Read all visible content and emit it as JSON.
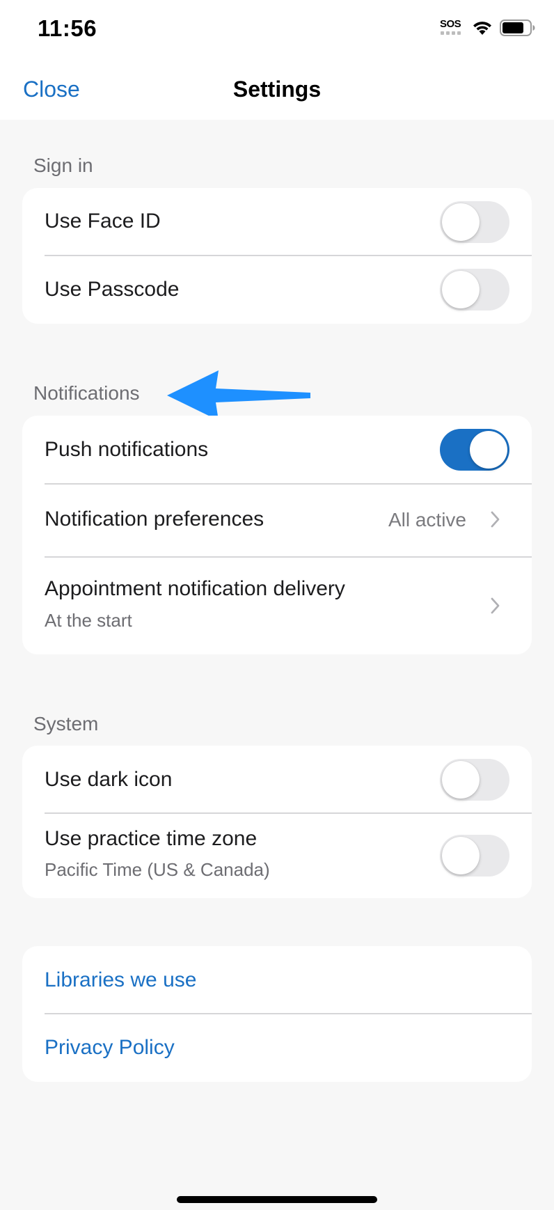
{
  "status_bar": {
    "time": "11:56",
    "sos": "SOS"
  },
  "nav": {
    "close_label": "Close",
    "title": "Settings"
  },
  "sections": {
    "sign_in": {
      "header": "Sign in",
      "rows": [
        {
          "label": "Use Face ID",
          "toggle_on": false
        },
        {
          "label": "Use Passcode",
          "toggle_on": false
        }
      ]
    },
    "notifications": {
      "header": "Notifications",
      "rows": [
        {
          "label": "Push notifications",
          "toggle_on": true
        },
        {
          "label": "Notification preferences",
          "value": "All active"
        },
        {
          "label": "Appointment notification delivery",
          "subtitle": "At the start"
        }
      ]
    },
    "system": {
      "header": "System",
      "rows": [
        {
          "label": "Use dark icon",
          "toggle_on": false
        },
        {
          "label": "Use practice time zone",
          "subtitle": "Pacific Time (US & Canada)",
          "toggle_on": false
        }
      ]
    },
    "links": {
      "rows": [
        {
          "label": "Libraries we use"
        },
        {
          "label": "Privacy Policy"
        }
      ]
    }
  },
  "colors": {
    "accent": "#1a70c4",
    "background": "#f7f7f7",
    "card": "#ffffff",
    "secondary_text": "#6d6d72",
    "annotation_arrow": "#1e90ff"
  }
}
